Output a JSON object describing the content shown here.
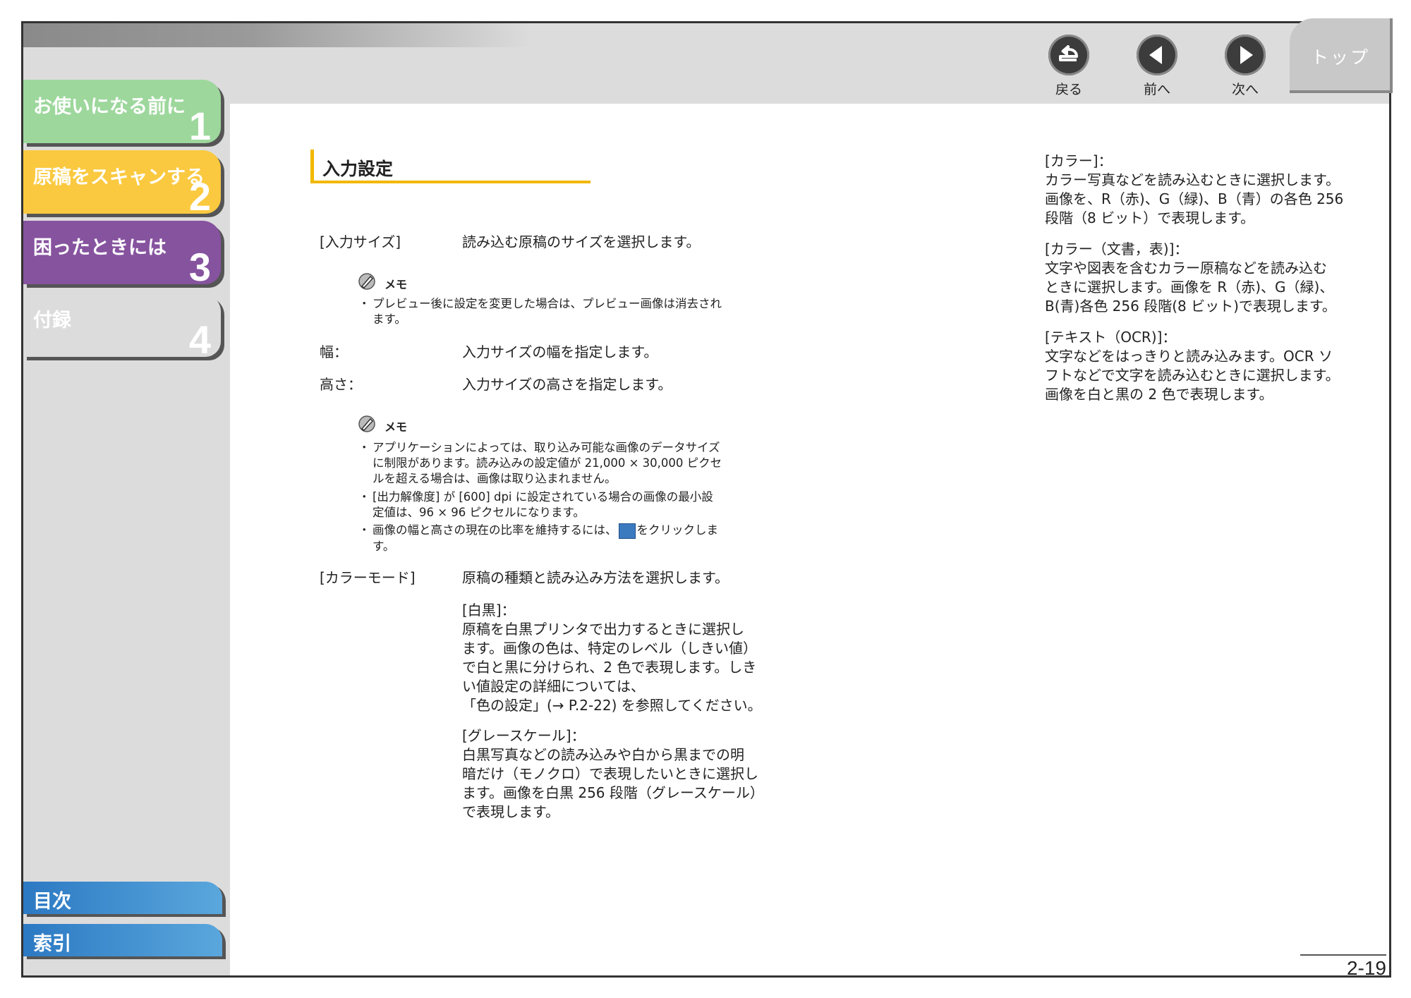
{
  "nav": {
    "back_label": "戻る",
    "prev_label": "前へ",
    "next_label": "次へ",
    "top_label": "トップ"
  },
  "sidebar": {
    "chapters": [
      {
        "label": "お使いになる前に",
        "num": "1"
      },
      {
        "label": "原稿をスキャンする",
        "num": "2"
      },
      {
        "label": "困ったときには",
        "num": "3"
      },
      {
        "label": "付録",
        "num": "4"
      }
    ],
    "toc_label": "目次",
    "index_label": "索引"
  },
  "section_title": "入力設定",
  "items": {
    "input_size_label": "[入力サイズ]",
    "input_size_desc": "読み込む原稿のサイズを選択します。",
    "memo_label": "メモ",
    "memo1_l1": "プレビュー後に設定を変更した場合は、プレビュー画像は消去され",
    "memo1_l2": "ます。",
    "width_label": "幅：",
    "width_desc": "入力サイズの幅を指定します。",
    "height_label": "高さ：",
    "height_desc": "入力サイズの高さを指定します。",
    "memo2_b1_l1": "アプリケーションによっては、取り込み可能な画像のデータサイズ",
    "memo2_b1_l2": "に制限があります。読み込みの設定値が 21,000 × 30,000 ピクセ",
    "memo2_b1_l3": "ルを超える場合は、画像は取り込まれません。",
    "memo2_b2_l1": "[出力解像度] が [600] dpi に設定されている場合の画像の最小設",
    "memo2_b2_l2": "定値は、96 × 96 ピクセルになります。",
    "memo2_b3_l1a": "画像の幅と高さの現在の比率を維持するには、",
    "memo2_b3_l1b": "をクリックしま",
    "memo2_b3_l2": "す。",
    "color_mode_label": "[カラーモード]",
    "color_mode_desc": "原稿の種類と読み込み方法を選択します。",
    "bw_title": "[白黒]：",
    "bw_l1": "原稿を白黒プリンタで出力するときに選択し",
    "bw_l2": "ます。画像の色は、特定のレベル（しきい値）",
    "bw_l3": "で白と黒に分けられ、2 色で表現します。しき",
    "bw_l4": "い値設定の詳細については、",
    "bw_l5": "「色の設定」(→ P.2-22) を参照してください。",
    "gray_title": "[グレースケール]：",
    "gray_l1": "白黒写真などの読み込みや白から黒までの明",
    "gray_l2": "暗だけ（モノクロ）で表現したいときに選択し",
    "gray_l3": "ます。画像を白黒 256 段階（グレースケール）",
    "gray_l4": "で表現します。"
  },
  "right_column": {
    "color_title": "[カラー]：",
    "color_l1": "カラー写真などを読み込むときに選択します。",
    "color_l2": "画像を、R（赤)、G（緑)、B（青）の各色 256",
    "color_l3": "段階（8 ビット）で表現します。",
    "colordoc_title": "[カラー（文書，表)]：",
    "colordoc_l1": "文字や図表を含むカラー原稿などを読み込む",
    "colordoc_l2": "ときに選択します。画像を R（赤)、G（緑)、",
    "colordoc_l3": "B(青)各色 256 段階(8 ビット)で表現します。",
    "text_title": "[テキスト（OCR)]：",
    "text_l1": "文字などをはっきりと読み込みます。OCR ソ",
    "text_l2": "フトなどで文字を読み込むときに選択します。",
    "text_l3": "画像を白と黒の 2 色で表現します。"
  },
  "page_number": "2-19",
  "colors": {
    "chapter1": "#9dd79c",
    "chapter2": "#fbc940",
    "chapter3": "#86539f",
    "heading_accent": "#f2b800",
    "nav_blue": "#2c79c3"
  }
}
